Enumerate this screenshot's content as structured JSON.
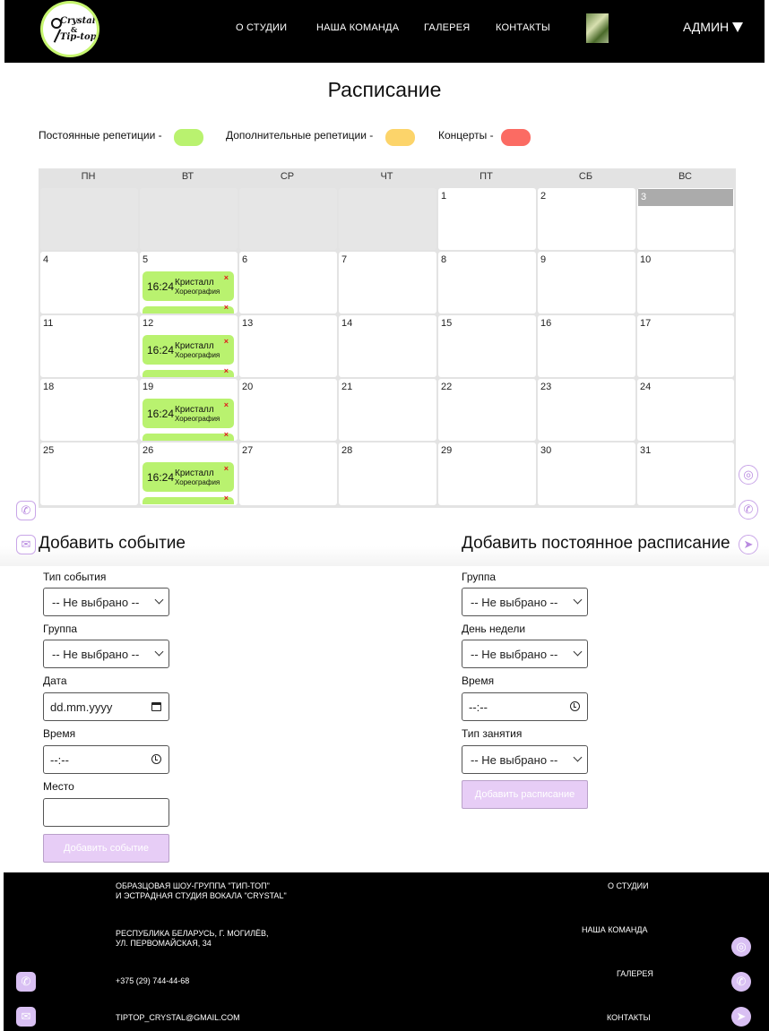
{
  "header": {
    "logo": {
      "line1": "Crystal",
      "line2": "&",
      "line3": "Tip-top"
    },
    "nav": [
      {
        "label": "О СТУДИИ"
      },
      {
        "label": "НАША КОМАНДА"
      },
      {
        "label": "ГАЛЕРЕЯ"
      },
      {
        "label": "КОНТАКТЫ"
      }
    ],
    "user": "АДМИН"
  },
  "page_title": "Расписание",
  "legend": [
    {
      "label": "Постоянные репетиции -",
      "color": "#b9f26f"
    },
    {
      "label": "Дополнительные репетиции -",
      "color": "#fcd46a"
    },
    {
      "label": "Концерты -",
      "color": "#fb6b63"
    }
  ],
  "calendar": {
    "weekdays": [
      "ПН",
      "ВТ",
      "СР",
      "ЧТ",
      "ПТ",
      "СБ",
      "ВС"
    ],
    "weeks": [
      [
        "",
        "",
        "",
        "",
        "1",
        "2",
        "3"
      ],
      [
        "4",
        "5",
        "6",
        "7",
        "8",
        "9",
        "10"
      ],
      [
        "11",
        "12",
        "13",
        "14",
        "15",
        "16",
        "17"
      ],
      [
        "18",
        "19",
        "20",
        "21",
        "22",
        "23",
        "24"
      ],
      [
        "25",
        "26",
        "27",
        "28",
        "29",
        "30",
        "31"
      ]
    ],
    "today": "3",
    "events": [
      {
        "time": "16:24",
        "group": "Кристалл",
        "type": "Хореография",
        "delete": "×"
      },
      {
        "time": "16:24",
        "group": "Кристалл",
        "type": "Хореография",
        "delete": "×"
      },
      {
        "time": "16:24",
        "group": "Кристалл",
        "type": "Хореография",
        "delete": "×"
      },
      {
        "time": "16:24",
        "group": "Кристалл",
        "type": "Хореография",
        "delete": "×"
      }
    ],
    "event_color": "#b9f26f"
  },
  "add_event": {
    "title": "Добавить событие",
    "type_label": "Тип события",
    "type_value": "-- Не выбрано --",
    "group_label": "Группа",
    "group_value": "-- Не выбрано --",
    "date_label": "Дата",
    "date_placeholder": "dd.mm.yyyy",
    "time_label": "Время",
    "time_placeholder": "--:--",
    "place_label": "Место",
    "place_value": "",
    "submit": "Добавить событие"
  },
  "add_schedule": {
    "title": "Добавить постоянное расписание",
    "group_label": "Группа",
    "group_value": "-- Не выбрано --",
    "day_label": "День недели",
    "day_value": "-- Не выбрано --",
    "time_label": "Время",
    "time_placeholder": "--:--",
    "lesson_label": "Тип занятия",
    "lesson_value": "-- Не выбрано --",
    "submit": "Добавить расписание"
  },
  "footer": {
    "org_line1": "ОБРАЗЦОВАЯ ШОУ-ГРУППА \"ТИП-ТОП\"",
    "org_line2": "И ЭСТРАДНАЯ СТУДИЯ ВОКАЛА \"CRYSTAL\"",
    "addr_line1": "РЕСПУБЛИКА БЕЛАРУСЬ, Г. МОГИЛЁВ,",
    "addr_line2": "УЛ. ПЕРВОМАЙСКАЯ, 34",
    "phone": "+375 (29) 744-44-68",
    "email": "TIPTOP_CRYSTAL@GMAIL.COM",
    "links": [
      {
        "label": "О СТУДИИ"
      },
      {
        "label": "НАША КОМАНДА"
      },
      {
        "label": "ГАЛЕРЕЯ"
      },
      {
        "label": "КОНТАКТЫ"
      }
    ]
  },
  "icons": {
    "phone": "phone-icon",
    "mail": "mail-icon",
    "instagram": "instagram-icon",
    "viber": "viber-icon",
    "telegram": "telegram-icon"
  },
  "colors": {
    "accent_lilac": "#e7cdf6",
    "icon_lilac": "#d9c0f3",
    "header_bg": "#000000",
    "logo_ring": "#c6f56f"
  }
}
